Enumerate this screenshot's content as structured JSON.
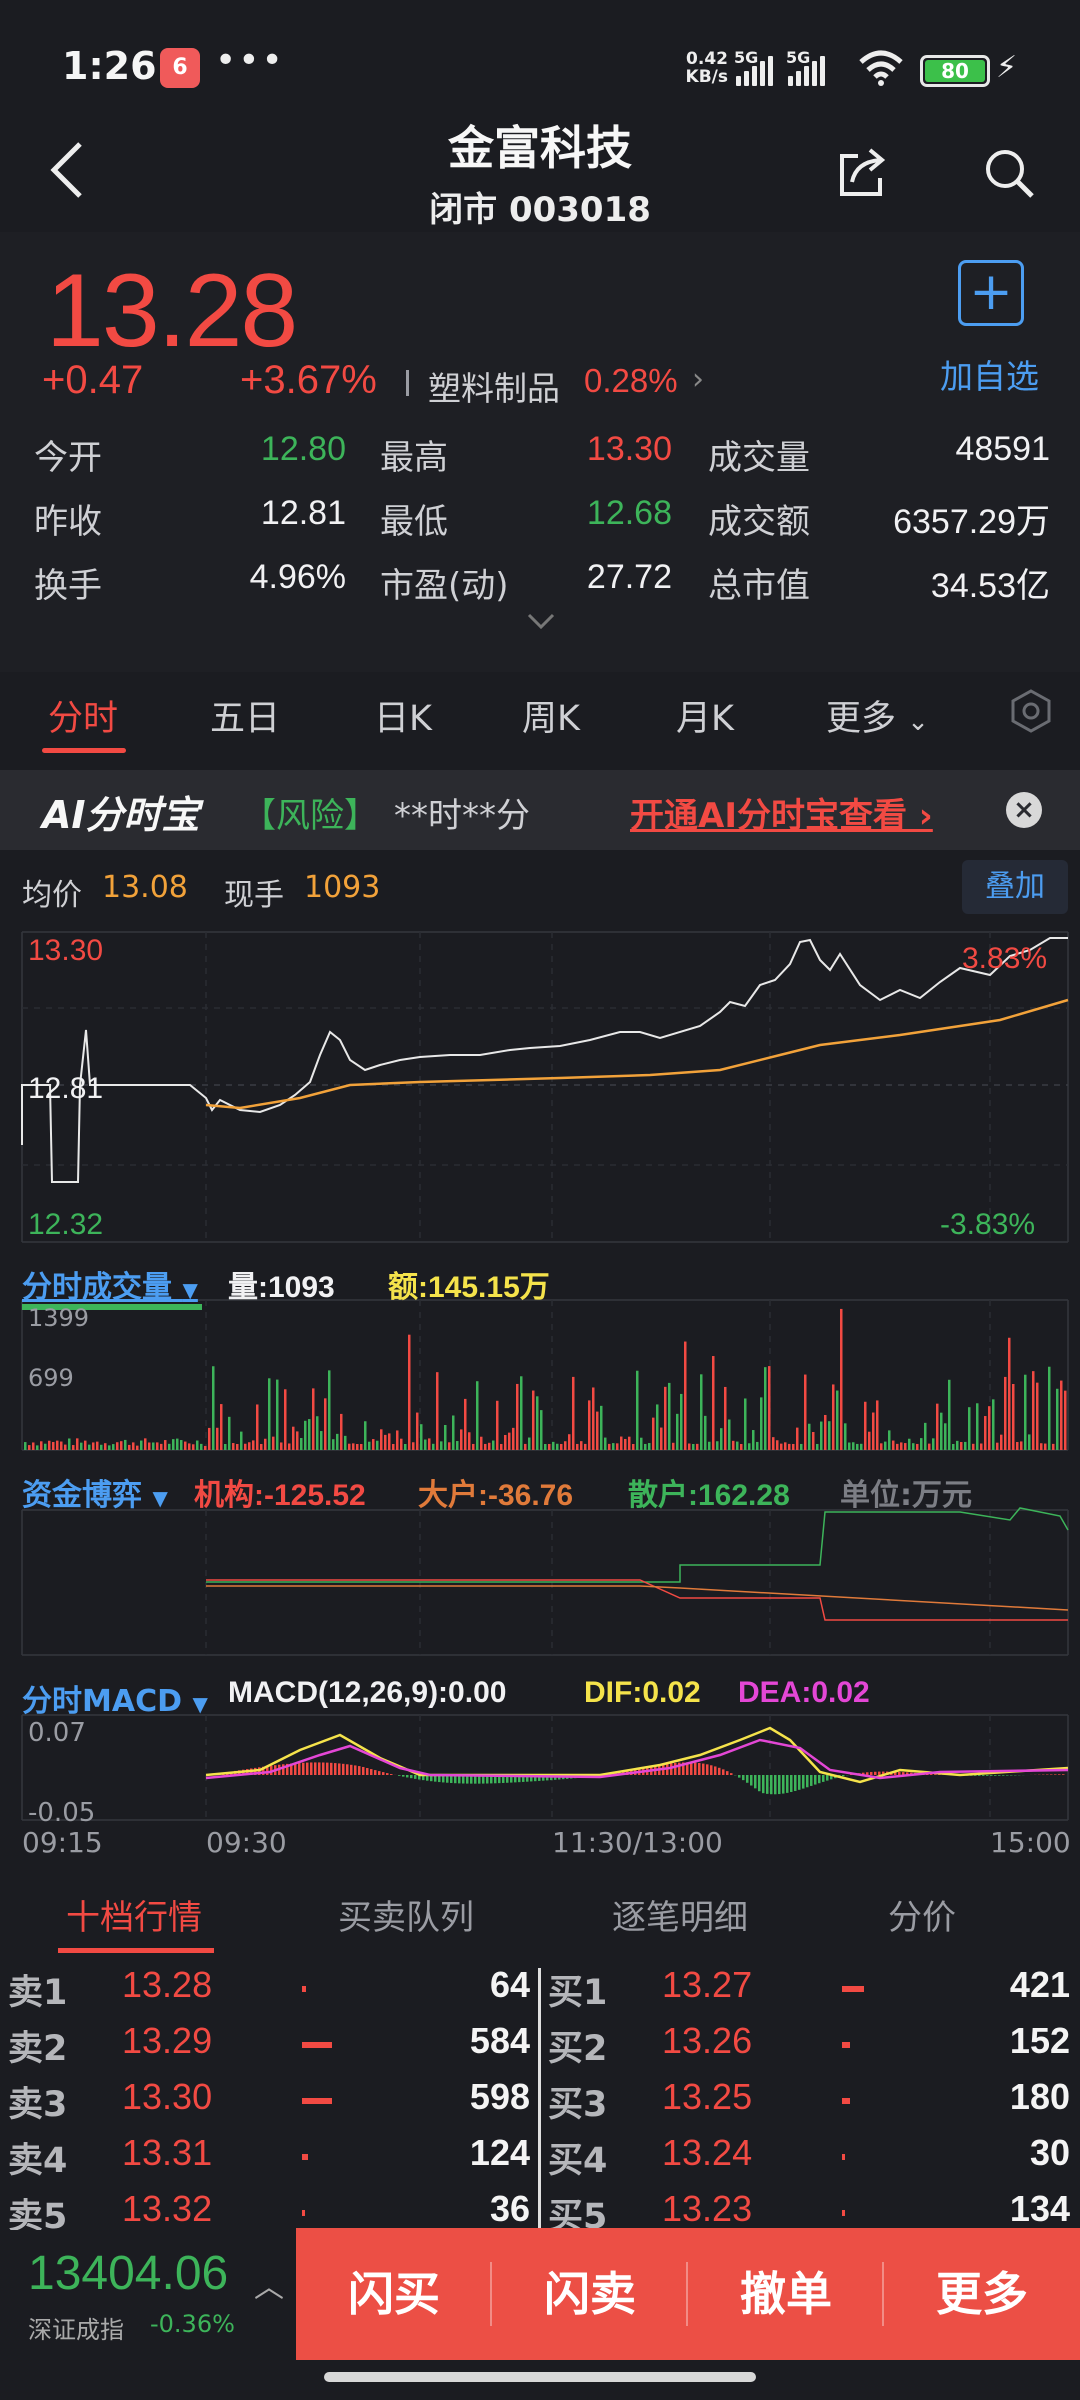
{
  "status_bar": {
    "time": "1:26",
    "app_badge": "6",
    "net_speed_value": "0.42",
    "net_speed_unit": "KB/s",
    "signal1": "5G",
    "signal2": "5G",
    "battery": "80"
  },
  "header": {
    "title": "金富科技",
    "subtitle": "闭市 003018"
  },
  "quote": {
    "price": "13.28",
    "change": "+0.47",
    "change_pct": "+3.67%",
    "sector": "塑料制品",
    "sector_pct": "0.28%",
    "add_label": "加自选",
    "stats": [
      {
        "label": "今开",
        "value": "12.80",
        "color": "green"
      },
      {
        "label": "最高",
        "value": "13.30",
        "color": "red"
      },
      {
        "label": "成交量",
        "value": "48591",
        "color": "white"
      },
      {
        "label": "昨收",
        "value": "12.81",
        "color": "white"
      },
      {
        "label": "最低",
        "value": "12.68",
        "color": "green"
      },
      {
        "label": "成交额",
        "value": "6357.29万",
        "color": "white"
      },
      {
        "label": "换手",
        "value": "4.96%",
        "color": "white"
      },
      {
        "label": "市盈(动)",
        "value": "27.72",
        "color": "white"
      },
      {
        "label": "总市值",
        "value": "34.53亿",
        "color": "white"
      }
    ]
  },
  "tabs": [
    "分时",
    "五日",
    "日K",
    "周K",
    "月K",
    "更多"
  ],
  "ai_banner": {
    "logo": "AI分时宝",
    "risk": "【风险】",
    "time": "**时**分",
    "cta": "开通AI分时宝查看 ›"
  },
  "chart_header": {
    "avg_label": "均价",
    "avg_value": "13.08",
    "hand_label": "现手",
    "hand_value": "1093",
    "overlay": "叠加"
  },
  "price_chart": {
    "y_high": "13.30",
    "y_mid": "12.81",
    "y_low": "12.32",
    "pct_high": "3.83%",
    "pct_low": "-3.83%"
  },
  "volume": {
    "title": "分时成交量",
    "vol_label": "量:",
    "vol_value": "1093",
    "amt_label": "额:",
    "amt_value": "145.15万",
    "tick_high": "1399",
    "tick_mid": "699"
  },
  "capital": {
    "title": "资金博弈",
    "inst": "机构:-125.52",
    "big": "大户:-36.76",
    "retail": "散户:162.28",
    "unit": "单位:万元"
  },
  "macd": {
    "title": "分时MACD",
    "params": "MACD(12,26,9):0.00",
    "dif": "DIF:0.02",
    "dea": "DEA:0.02",
    "tick_high": "0.07",
    "tick_low": "-0.05",
    "x_labels": [
      "09:15",
      "09:30",
      "11:30/13:00",
      "15:00"
    ]
  },
  "colors": {
    "red": "#f24a43",
    "green": "#3db45a",
    "avg_line": "#f2a23a",
    "blue": "#4c9df1"
  },
  "orderbook": {
    "tabs": [
      "十档行情",
      "买卖队列",
      "逐笔明细",
      "分价"
    ],
    "sell": [
      {
        "label": "卖1",
        "price": "13.28",
        "vol": "64"
      },
      {
        "label": "卖2",
        "price": "13.29",
        "vol": "584"
      },
      {
        "label": "卖3",
        "price": "13.30",
        "vol": "598"
      },
      {
        "label": "卖4",
        "price": "13.31",
        "vol": "124"
      },
      {
        "label": "卖5",
        "price": "13.32",
        "vol": "36"
      }
    ],
    "buy": [
      {
        "label": "买1",
        "price": "13.27",
        "vol": "421"
      },
      {
        "label": "买2",
        "price": "13.26",
        "vol": "152"
      },
      {
        "label": "买3",
        "price": "13.25",
        "vol": "180"
      },
      {
        "label": "买4",
        "price": "13.24",
        "vol": "30"
      },
      {
        "label": "买5",
        "price": "13.23",
        "vol": "134"
      }
    ]
  },
  "bottom": {
    "index_value": "13404.06",
    "index_name": "深证成指",
    "index_pct": "-0.36%",
    "actions": [
      "闪买",
      "闪卖",
      "撤单",
      "更多"
    ]
  }
}
